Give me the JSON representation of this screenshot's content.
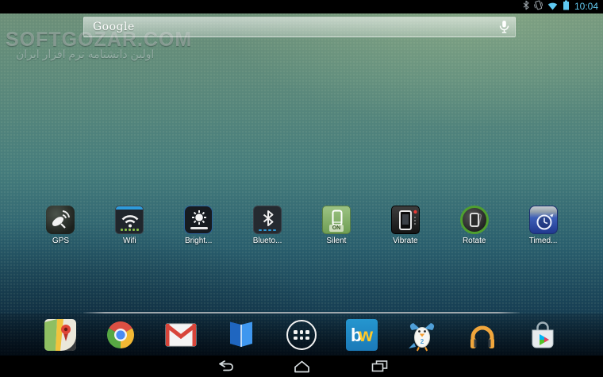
{
  "status_bar": {
    "time": "10:04",
    "icons": [
      "bluetooth-icon",
      "vibrate-icon",
      "wifi-icon",
      "battery-icon"
    ],
    "accent_color": "#62c9ef"
  },
  "search": {
    "logo_text": "Google",
    "mic_icon": "microphone-icon"
  },
  "watermark": {
    "title": "SOFTGOZAR.COM",
    "subtitle": "اولین دانشنامه نرم افزار ایران"
  },
  "shortcuts": {
    "items": [
      {
        "label": "GPS",
        "icon": "gps-satellite-icon"
      },
      {
        "label": "Wifi",
        "icon": "wifi-toggle-icon"
      },
      {
        "label": "Bright...",
        "icon": "brightness-toggle-icon"
      },
      {
        "label": "Blueto...",
        "icon": "bluetooth-toggle-icon"
      },
      {
        "label": "Silent",
        "icon": "silent-phone-icon",
        "badge": "ON"
      },
      {
        "label": "Vibrate",
        "icon": "vibrate-phone-icon"
      },
      {
        "label": "Rotate",
        "icon": "rotate-phone-icon"
      },
      {
        "label": "Timed...",
        "icon": "timed-clock-icon"
      }
    ]
  },
  "dock": {
    "items": [
      {
        "icon": "google-maps-icon"
      },
      {
        "icon": "chrome-icon"
      },
      {
        "icon": "gmail-icon"
      },
      {
        "icon": "play-books-icon"
      },
      {
        "icon": "app-drawer-icon"
      },
      {
        "icon": "bw-app-icon",
        "letter_b": "b",
        "letter_w": "w"
      },
      {
        "icon": "bird-app-icon",
        "badge": "2"
      },
      {
        "icon": "play-music-icon"
      },
      {
        "icon": "play-store-icon"
      }
    ]
  },
  "nav_bar": {
    "buttons": [
      "back",
      "home",
      "recents"
    ]
  },
  "colors": {
    "wallpaper_top": "#6f9078",
    "wallpaper_mid": "#457c7c",
    "wallpaper_bottom": "#0d2b40",
    "status_accent": "#62c9ef"
  }
}
